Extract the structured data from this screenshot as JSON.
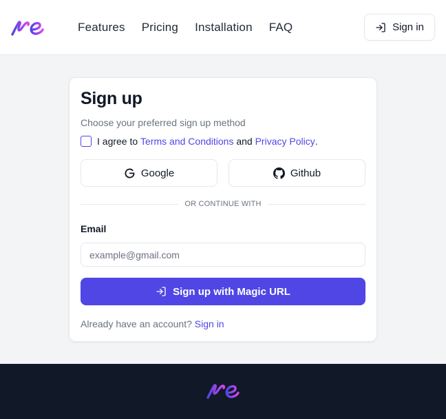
{
  "header": {
    "nav": [
      "Features",
      "Pricing",
      "Installation",
      "FAQ"
    ],
    "signin_label": "Sign in"
  },
  "card": {
    "title": "Sign up",
    "subtitle": "Choose your preferred sign up method",
    "agree": {
      "prefix": "I agree to",
      "terms_link": "Terms and Conditions",
      "conjunction": "and",
      "privacy_link": "Privacy Policy",
      "suffix": "."
    },
    "google_label": "Google",
    "github_label": "Github",
    "divider_text": "OR CONTINUE WITH",
    "email_label": "Email",
    "email_placeholder": "example@gmail.com",
    "email_value": "",
    "submit_label": "Sign up with Magic URL",
    "have_account_text": "Already have an account?",
    "signin_link": "Sign in"
  },
  "icons": {
    "logo": "re-logo",
    "signin": "sign-in-icon",
    "google": "google-icon",
    "github": "github-icon"
  },
  "colors": {
    "primary": "#4f46e5",
    "logo_start": "#4f46e5",
    "logo_end": "#d946ef",
    "footer_bg": "#111827",
    "page_bg": "#f3f4f6"
  }
}
